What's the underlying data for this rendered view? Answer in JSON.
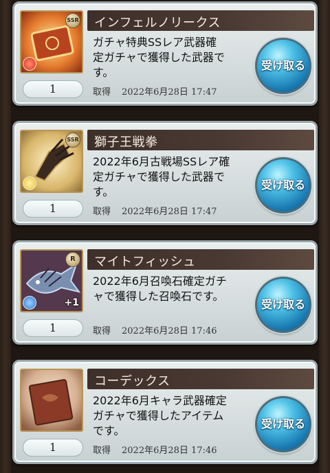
{
  "items": [
    {
      "name": "インフェルノリークス",
      "description_lines": [
        "ガチャ特典SSレア武器確",
        "定ガチャで獲得した武器で",
        "す。"
      ],
      "quantity": "1",
      "acquired_label": "取得",
      "acquired_date": "2022年6月28日 17:47",
      "rarity": "SSR",
      "element": "fire",
      "plus": "",
      "receive_label": "受け取る",
      "thumb_colors": [
        "#ffe9a0",
        "#e3782c",
        "#8a2e12"
      ]
    },
    {
      "name": "獅子王戦拳",
      "description_lines": [
        "2022年6月古戦場SSレア確",
        "定ガチャで獲得した武器で",
        "す。"
      ],
      "quantity": "1",
      "acquired_label": "取得",
      "acquired_date": "2022年6月28日 17:47",
      "rarity": "SSR",
      "element": "light",
      "plus": "",
      "receive_label": "受け取る",
      "thumb_colors": [
        "#fff3c9",
        "#d8b56a",
        "#3a2a20"
      ]
    },
    {
      "name": "マイトフィッシュ",
      "description_lines": [
        "2022年6月召喚石確定ガチ",
        "ャで獲得した召喚石です。"
      ],
      "quantity": "1",
      "acquired_label": "取得",
      "acquired_date": "2022年6月28日 17:46",
      "rarity": "R",
      "element": "water",
      "plus": "+1",
      "receive_label": "受け取る",
      "thumb_colors": [
        "#8a5c70",
        "#54384e",
        "#2b2236"
      ]
    },
    {
      "name": "コーデックス",
      "description_lines": [
        "2022年6月キャラ武器確定",
        "ガチャで獲得したアイテム",
        "です。"
      ],
      "quantity": "1",
      "acquired_label": "取得",
      "acquired_date": "2022年6月28日 17:46",
      "rarity": "",
      "element": "",
      "plus": "",
      "receive_label": "受け取る",
      "thumb_colors": [
        "#e6cdb6",
        "#a86b4c",
        "#4a2418"
      ]
    }
  ],
  "colors": {
    "fire": "#d8311f",
    "light": "#e9c23c",
    "water": "#2d79d8"
  }
}
